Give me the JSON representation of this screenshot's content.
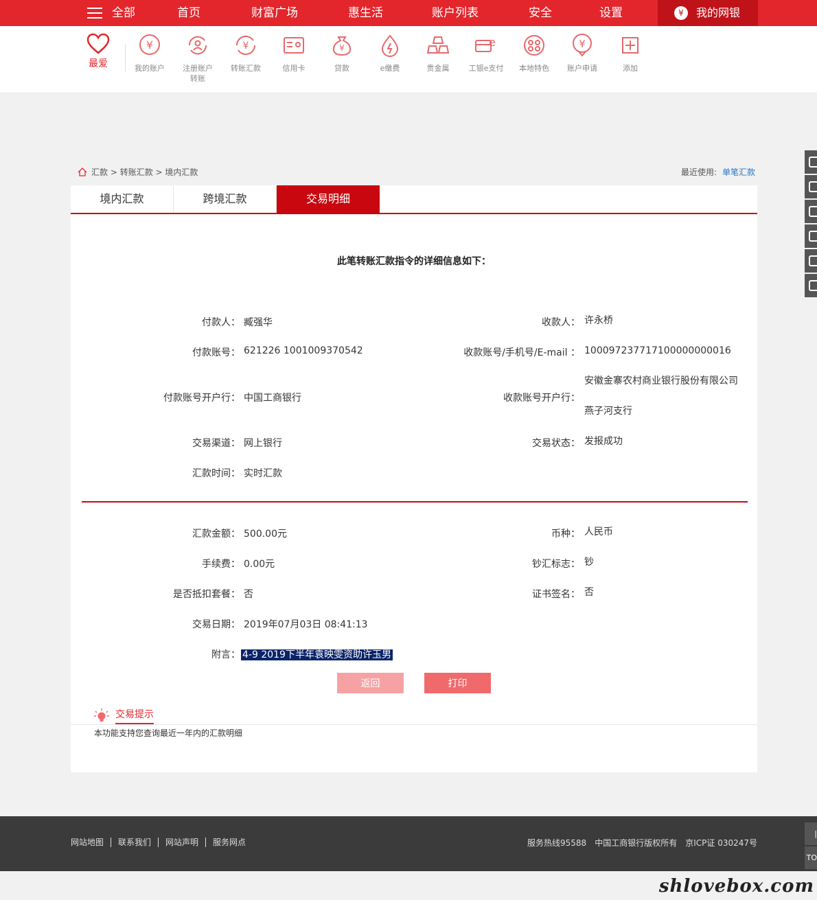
{
  "nav": {
    "all": "全部",
    "items": [
      "首页",
      "财富广场",
      "惠生活",
      "账户列表",
      "安全",
      "设置"
    ],
    "mybank": "我的网银"
  },
  "quick": {
    "fav": "最爱",
    "items": [
      "我的账户",
      "注册账户\n转账",
      "转账汇款",
      "信用卡",
      "贷款",
      "e缴费",
      "贵金属",
      "工银e支付",
      "本地特色",
      "账户申请",
      "添加"
    ]
  },
  "breadcrumb": [
    "汇款",
    "转账汇款",
    "境内汇款"
  ],
  "recent": {
    "label": "最近使用:",
    "link": "单笔汇款"
  },
  "tabs": [
    "境内汇款",
    "跨境汇款",
    "交易明细"
  ],
  "detail": {
    "title": "此笔转账汇款指令的详细信息如下：",
    "payer_label": "付款人：",
    "payer": "臧强华",
    "payee_label": "收款人：",
    "payee": "许永桥",
    "payer_acct_label": "付款账号：",
    "payer_acct": "621226 1001009370542",
    "payee_acct_label": "收款账号/手机号/E-mail ：",
    "payee_acct": "100097237717100000000016",
    "payer_bank_label": "付款账号开户行：",
    "payer_bank": "中国工商银行",
    "payee_bank_label": "收款账号开户行：",
    "payee_bank_1": "安徽金寨农村商业银行股份有限公司",
    "payee_bank_2": "燕子河支行",
    "channel_label": "交易渠道：",
    "channel": "网上银行",
    "status_label": "交易状态：",
    "status": "发报成功",
    "time_label": "汇款时间：",
    "time": "实时汇款",
    "amount_label": "汇款金额：",
    "amount": "500.00元",
    "currency_label": "币种：",
    "currency": "人民币",
    "fee_label": "手续费：",
    "fee": "0.00元",
    "cash_label": "钞汇标志：",
    "cash": "钞",
    "package_label": "是否抵扣套餐：",
    "package": "否",
    "cert_label": "证书签名：",
    "cert": "否",
    "date_label": "交易日期：",
    "date": "2019年07月03日 08:41:13",
    "memo_label": "附言：",
    "memo": "4-9 2019下半年袁映雯资助许玉男"
  },
  "buttons": {
    "back": "返回",
    "print": "打印"
  },
  "tips": {
    "title": "交易提示",
    "text": "本功能支持您查询最近一年内的汇款明细"
  },
  "footer": {
    "links": [
      "网站地图",
      "联系我们",
      "网站声明",
      "服务网点"
    ],
    "hotline": "服务热线95588",
    "copyright": "中国工商银行版权所有",
    "icp": "京ICP证 030247号"
  },
  "totop": {
    "label": "TO"
  },
  "watermark": "shlovebox.com",
  "colors": {
    "brand_red": "#e3262c",
    "tab_red": "#c8070f"
  }
}
